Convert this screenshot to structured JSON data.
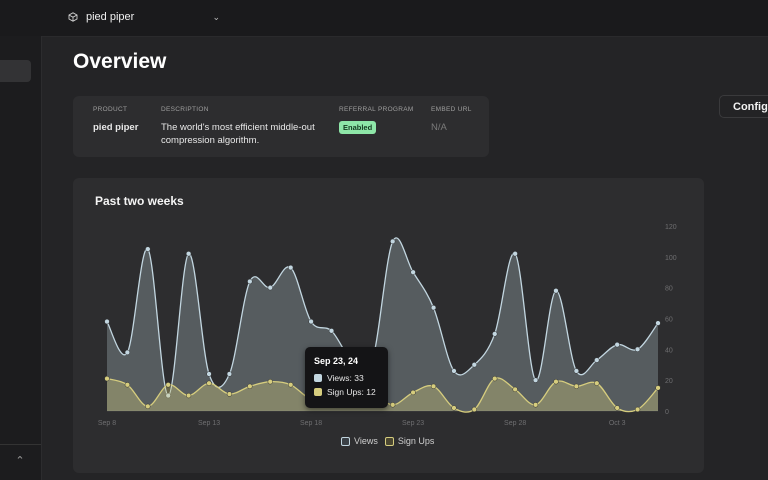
{
  "project": {
    "name": "pied piper"
  },
  "page": {
    "title": "Overview"
  },
  "actions": {
    "configure_label": "Configure"
  },
  "info": {
    "product_label": "PRODUCT",
    "product_value": "pied piper",
    "description_label": "DESCRIPTION",
    "description_value": "The world's most efficient middle-out compression algorithm.",
    "referral_label": "REFERRAL PROGRAM",
    "referral_value": "Enabled",
    "embed_label": "EMBED URL",
    "embed_value": "N/A"
  },
  "colors": {
    "views": "#c2d6e0",
    "signups": "#d6cd7e",
    "badge_bg": "#8ee6a8"
  },
  "icons": {
    "project": "cube-icon",
    "dropdown": "chevron-down-icon",
    "sidebar_toggle": "chevron-up-icon"
  },
  "chart_data": {
    "type": "area",
    "title": "Past two weeks",
    "x_ticks": [
      "Sep 8",
      "Sep 13",
      "Sep 18",
      "Sep 23",
      "Sep 28",
      "Oct 3"
    ],
    "y_ticks": [
      0,
      20,
      40,
      60,
      80,
      100,
      120
    ],
    "ylim": [
      0,
      120
    ],
    "grid": false,
    "legend_position": "bottom",
    "series": [
      {
        "name": "Views",
        "values": [
          58,
          38,
          105,
          10,
          102,
          24,
          24,
          84,
          80,
          93,
          58,
          52,
          33,
          33,
          110,
          90,
          67,
          26,
          30,
          50,
          102,
          20,
          78,
          26,
          33,
          43,
          40,
          57
        ]
      },
      {
        "name": "Sign Ups",
        "values": [
          21,
          17,
          3,
          17,
          10,
          18,
          11,
          16,
          19,
          17,
          8,
          12,
          12,
          12,
          4,
          12,
          16,
          2,
          1,
          21,
          14,
          4,
          19,
          16,
          18,
          2,
          1,
          15
        ]
      }
    ],
    "tooltip": {
      "date": "Sep 23, 24",
      "views_label": "Views: 33",
      "signups_label": "Sign Ups: 12"
    }
  }
}
